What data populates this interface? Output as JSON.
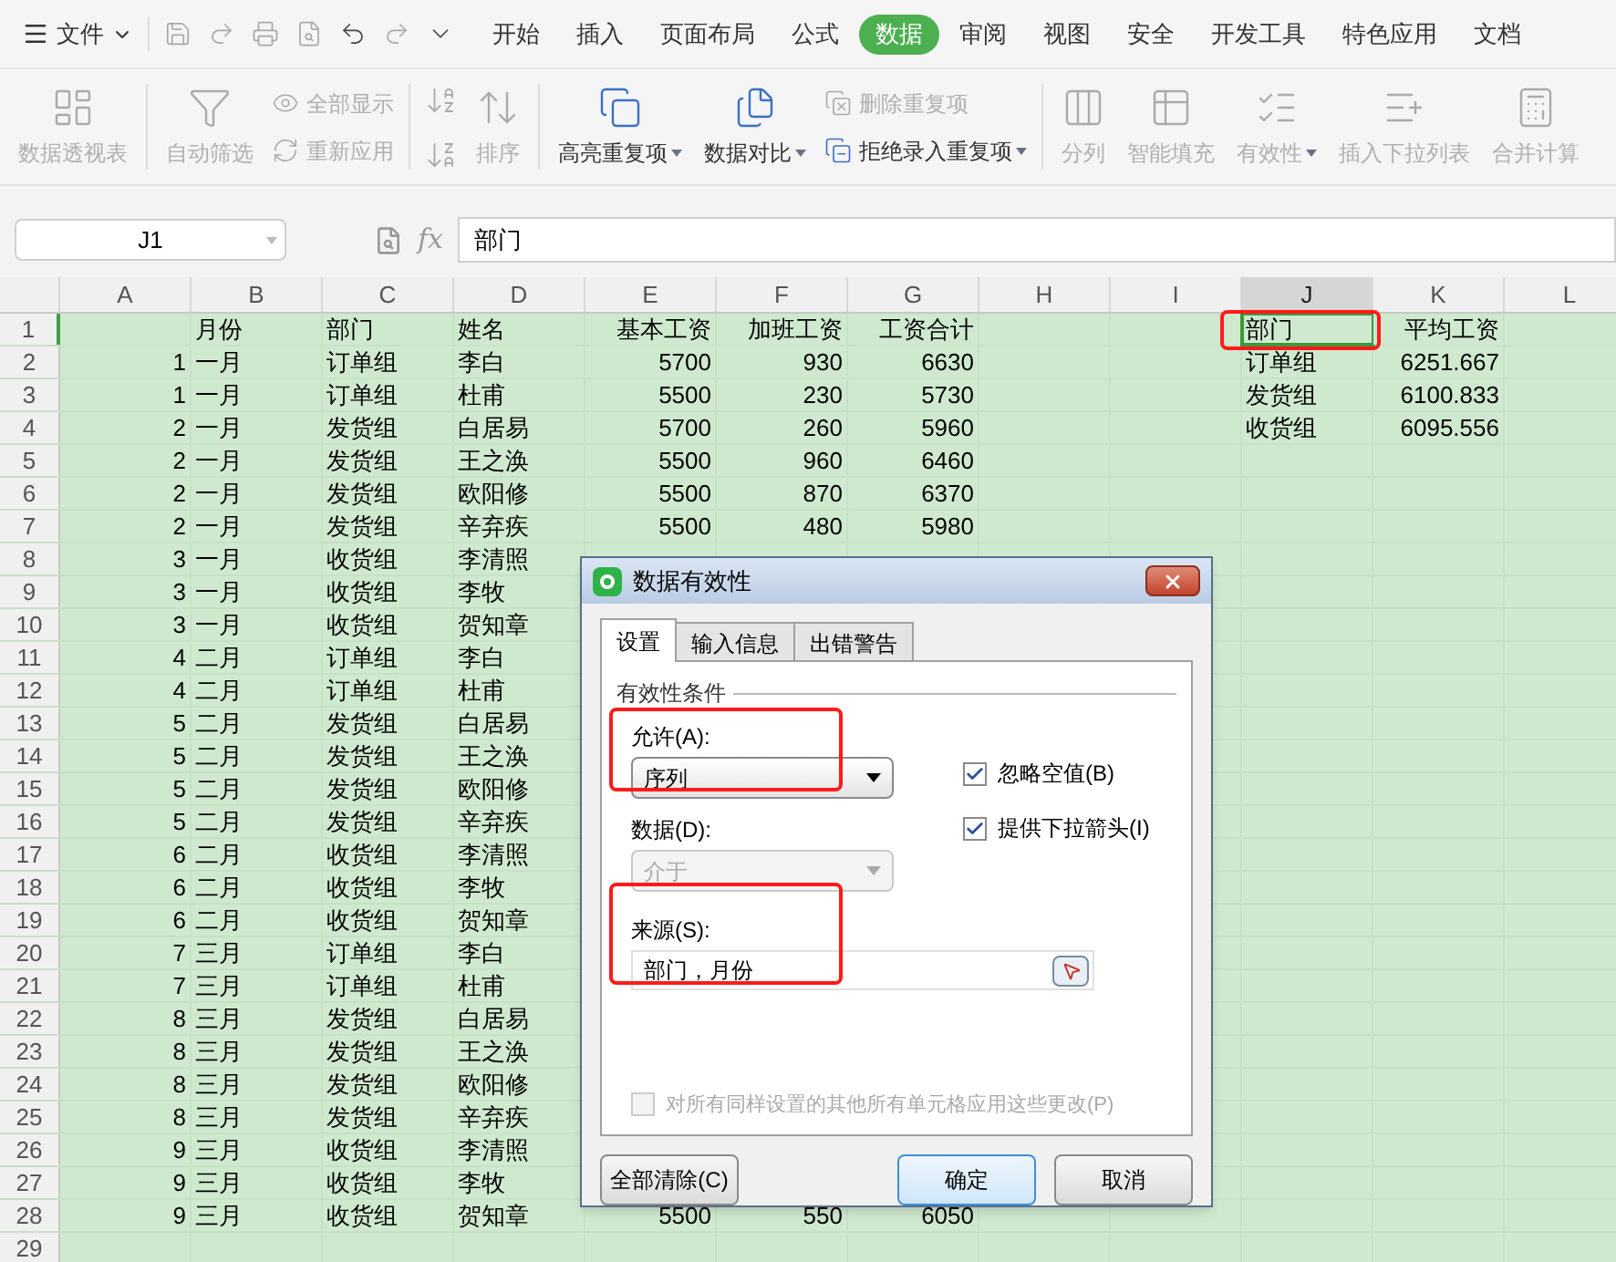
{
  "menu": {
    "file_label": "文件",
    "tabs": [
      {
        "label": "开始",
        "selected": false
      },
      {
        "label": "插入",
        "selected": false
      },
      {
        "label": "页面布局",
        "selected": false
      },
      {
        "label": "公式",
        "selected": false
      },
      {
        "label": "数据",
        "selected": true
      },
      {
        "label": "审阅",
        "selected": false
      },
      {
        "label": "视图",
        "selected": false
      },
      {
        "label": "安全",
        "selected": false
      },
      {
        "label": "开发工具",
        "selected": false
      },
      {
        "label": "特色应用",
        "selected": false
      },
      {
        "label": "文档",
        "selected": false
      }
    ]
  },
  "ribbon": [
    {
      "kind": "large",
      "label": "数据透视表",
      "disabled": true,
      "caret": false
    },
    {
      "kind": "separator"
    },
    {
      "kind": "large",
      "label": "自动筛选",
      "disabled": true,
      "caret": false
    },
    {
      "kind": "stack",
      "items": [
        {
          "label": "全部显示",
          "disabled": true,
          "caret": false
        },
        {
          "label": "重新应用",
          "disabled": true,
          "caret": false
        }
      ]
    },
    {
      "kind": "separator"
    },
    {
      "kind": "sort_icons",
      "disabled": true
    },
    {
      "kind": "large",
      "label": "排序",
      "disabled": true,
      "caret": false
    },
    {
      "kind": "separator"
    },
    {
      "kind": "large",
      "label": "高亮重复项",
      "disabled": false,
      "caret": true
    },
    {
      "kind": "large",
      "label": "数据对比",
      "disabled": false,
      "caret": true
    },
    {
      "kind": "stack",
      "items": [
        {
          "label": "删除重复项",
          "disabled": true,
          "caret": false
        },
        {
          "label": "拒绝录入重复项",
          "disabled": false,
          "caret": true
        }
      ]
    },
    {
      "kind": "separator"
    },
    {
      "kind": "large",
      "label": "分列",
      "disabled": true,
      "caret": false
    },
    {
      "kind": "large",
      "label": "智能填充",
      "disabled": true,
      "caret": false
    },
    {
      "kind": "large",
      "label": "有效性",
      "disabled": true,
      "caret": true
    },
    {
      "kind": "large",
      "label": "插入下拉列表",
      "disabled": true,
      "caret": false
    },
    {
      "kind": "large",
      "label": "合并计算",
      "disabled": true,
      "caret": false
    }
  ],
  "formula_bar": {
    "name_box": "J1",
    "fx": "fx",
    "formula": "部门"
  },
  "grid": {
    "active_cell_highlighted": true,
    "columns": [
      {
        "label": "A",
        "kind": "number",
        "selected": false
      },
      {
        "label": "B",
        "kind": "text",
        "selected": false
      },
      {
        "label": "C",
        "kind": "text",
        "selected": false
      },
      {
        "label": "D",
        "kind": "text",
        "selected": false
      },
      {
        "label": "E",
        "kind": "number",
        "selected": false
      },
      {
        "label": "F",
        "kind": "number",
        "selected": false
      },
      {
        "label": "G",
        "kind": "number",
        "selected": false
      },
      {
        "label": "H",
        "kind": "text",
        "selected": false
      },
      {
        "label": "I",
        "kind": "text",
        "selected": false
      },
      {
        "label": "J",
        "kind": "text",
        "selected": true
      },
      {
        "label": "K",
        "kind": "number",
        "selected": false
      },
      {
        "label": "L",
        "kind": "text",
        "selected": false
      }
    ],
    "rows": [
      {
        "number": "1",
        "selected": true,
        "cells": {
          "B": "月份",
          "C": "部门",
          "D": "姓名",
          "E": "基本工资",
          "F": "加班工资",
          "G": "工资合计",
          "J": "部门",
          "K": "平均工资"
        }
      },
      {
        "number": "2",
        "selected": false,
        "cells": {
          "A": "1",
          "B": "一月",
          "C": "订单组",
          "D": "李白",
          "E": "5700",
          "F": "930",
          "G": "6630",
          "J": "订单组",
          "K": "6251.667"
        }
      },
      {
        "number": "3",
        "selected": false,
        "cells": {
          "A": "1",
          "B": "一月",
          "C": "订单组",
          "D": "杜甫",
          "E": "5500",
          "F": "230",
          "G": "5730",
          "J": "发货组",
          "K": "6100.833"
        }
      },
      {
        "number": "4",
        "selected": false,
        "cells": {
          "A": "2",
          "B": "一月",
          "C": "发货组",
          "D": "白居易",
          "E": "5700",
          "F": "260",
          "G": "5960",
          "J": "收货组",
          "K": "6095.556"
        }
      },
      {
        "number": "5",
        "selected": false,
        "cells": {
          "A": "2",
          "B": "一月",
          "C": "发货组",
          "D": "王之涣",
          "E": "5500",
          "F": "960",
          "G": "6460"
        }
      },
      {
        "number": "6",
        "selected": false,
        "cells": {
          "A": "2",
          "B": "一月",
          "C": "发货组",
          "D": "欧阳修",
          "E": "5500",
          "F": "870",
          "G": "6370"
        }
      },
      {
        "number": "7",
        "selected": false,
        "cells": {
          "A": "2",
          "B": "一月",
          "C": "发货组",
          "D": "辛弃疾",
          "E": "5500",
          "F": "480",
          "G": "5980"
        }
      },
      {
        "number": "8",
        "selected": false,
        "cells": {
          "A": "3",
          "B": "一月",
          "C": "收货组",
          "D": "李清照"
        }
      },
      {
        "number": "9",
        "selected": false,
        "cells": {
          "A": "3",
          "B": "一月",
          "C": "收货组",
          "D": "李牧"
        }
      },
      {
        "number": "10",
        "selected": false,
        "cells": {
          "A": "3",
          "B": "一月",
          "C": "收货组",
          "D": "贺知章"
        }
      },
      {
        "number": "11",
        "selected": false,
        "cells": {
          "A": "4",
          "B": "二月",
          "C": "订单组",
          "D": "李白"
        }
      },
      {
        "number": "12",
        "selected": false,
        "cells": {
          "A": "4",
          "B": "二月",
          "C": "订单组",
          "D": "杜甫"
        }
      },
      {
        "number": "13",
        "selected": false,
        "cells": {
          "A": "5",
          "B": "二月",
          "C": "发货组",
          "D": "白居易"
        }
      },
      {
        "number": "14",
        "selected": false,
        "cells": {
          "A": "5",
          "B": "二月",
          "C": "发货组",
          "D": "王之涣"
        }
      },
      {
        "number": "15",
        "selected": false,
        "cells": {
          "A": "5",
          "B": "二月",
          "C": "发货组",
          "D": "欧阳修"
        }
      },
      {
        "number": "16",
        "selected": false,
        "cells": {
          "A": "5",
          "B": "二月",
          "C": "发货组",
          "D": "辛弃疾"
        }
      },
      {
        "number": "17",
        "selected": false,
        "cells": {
          "A": "6",
          "B": "二月",
          "C": "收货组",
          "D": "李清照"
        }
      },
      {
        "number": "18",
        "selected": false,
        "cells": {
          "A": "6",
          "B": "二月",
          "C": "收货组",
          "D": "李牧"
        }
      },
      {
        "number": "19",
        "selected": false,
        "cells": {
          "A": "6",
          "B": "二月",
          "C": "收货组",
          "D": "贺知章"
        }
      },
      {
        "number": "20",
        "selected": false,
        "cells": {
          "A": "7",
          "B": "三月",
          "C": "订单组",
          "D": "李白"
        }
      },
      {
        "number": "21",
        "selected": false,
        "cells": {
          "A": "7",
          "B": "三月",
          "C": "订单组",
          "D": "杜甫"
        }
      },
      {
        "number": "22",
        "selected": false,
        "cells": {
          "A": "8",
          "B": "三月",
          "C": "发货组",
          "D": "白居易"
        }
      },
      {
        "number": "23",
        "selected": false,
        "cells": {
          "A": "8",
          "B": "三月",
          "C": "发货组",
          "D": "王之涣"
        }
      },
      {
        "number": "24",
        "selected": false,
        "cells": {
          "A": "8",
          "B": "三月",
          "C": "发货组",
          "D": "欧阳修"
        }
      },
      {
        "number": "25",
        "selected": false,
        "cells": {
          "A": "8",
          "B": "三月",
          "C": "发货组",
          "D": "辛弃疾"
        }
      },
      {
        "number": "26",
        "selected": false,
        "cells": {
          "A": "9",
          "B": "三月",
          "C": "收货组",
          "D": "李清照"
        }
      },
      {
        "number": "27",
        "selected": false,
        "cells": {
          "A": "9",
          "B": "三月",
          "C": "收货组",
          "D": "李牧"
        }
      },
      {
        "number": "28",
        "selected": false,
        "cells": {
          "A": "9",
          "B": "三月",
          "C": "收货组",
          "D": "贺知章",
          "E": "5500",
          "F": "550",
          "G": "6050"
        }
      },
      {
        "number": "29",
        "selected": false,
        "cells": {}
      }
    ]
  },
  "dialog": {
    "title": "数据有效性",
    "tabs": [
      {
        "label": "设置",
        "selected": true
      },
      {
        "label": "输入信息",
        "selected": false
      },
      {
        "label": "出错警告",
        "selected": false
      }
    ],
    "section": "有效性条件",
    "allow": {
      "label": "允许(A):",
      "value": "序列",
      "highlighted": true
    },
    "data": {
      "label": "数据(D):",
      "value": "介于",
      "disabled": true
    },
    "source": {
      "label": "来源(S):",
      "value": "部门，月份",
      "highlighted": true
    },
    "options": [
      {
        "label": "忽略空值(B)",
        "checked": true,
        "disabled": false
      },
      {
        "label": "提供下拉箭头(I)",
        "checked": true,
        "disabled": false
      }
    ],
    "apply_all": {
      "label": "对所有同样设置的其他所有单元格应用这些更改(P)",
      "checked": false,
      "disabled": true
    },
    "buttons": [
      {
        "label": "全部清除(C)",
        "kind": "default"
      },
      {
        "label": "确定",
        "kind": "primary"
      },
      {
        "label": "取消",
        "kind": "default"
      }
    ]
  }
}
